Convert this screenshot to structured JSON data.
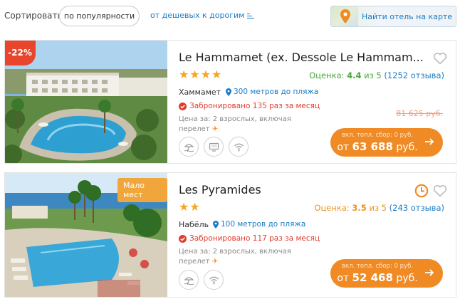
{
  "sort": {
    "label": "Сортировать:",
    "popularity": "по популярности",
    "price": "от дешевых к дорогим",
    "price_icon": "sort-ascending-icon"
  },
  "map": {
    "label": "Найти отель на карте",
    "icon": "map-pin-icon"
  },
  "colors": {
    "accent": "#f08a24",
    "link": "#1a7bc4",
    "discount": "#e8452c",
    "rating_good": "#4aa63f",
    "rating_mid": "#e8961a",
    "booked": "#e23b2e",
    "badge": "#f0a63a"
  },
  "hotels": [
    {
      "discount": "-22%",
      "name": "Le Hammamet (ex. Dessole Le Hammam...",
      "stars": "★★★★",
      "star_count": 4,
      "rating": {
        "label": "Оценка:",
        "value": "4.4",
        "of": "из 5",
        "reviews": "(1252 отзыва)"
      },
      "city": "Хаммамет",
      "beach": "300 метров до пляжа",
      "booked": "Забронировано 135 раз за месяц",
      "old_price": "81 625 руб.",
      "price_note_line1": "Цена за: 2 взрослых, включая",
      "price_note_line2": "перелет",
      "fee": "вкл. топл. сбор: 0 руб.",
      "price_prefix": "от",
      "price": "63 688",
      "currency": "руб.",
      "amenities": [
        "beach-umbrella-icon",
        "tv-icon",
        "wifi-icon"
      ]
    },
    {
      "badge": "Мало мест",
      "name": "Les Pyramides",
      "stars": "★★",
      "star_count": 2,
      "rating": {
        "label": "Оценка:",
        "value": "3.5",
        "of": "из 5",
        "reviews": "(243 отзыва)"
      },
      "city": "Набёль",
      "beach": "100 метров до пляжа",
      "booked": "Забронировано 117 раз за месяц",
      "price_note_line1": "Цена за: 2 взрослых, включая",
      "price_note_line2": "перелет",
      "fee": "вкл. топл. сбор: 0 руб.",
      "price_prefix": "от",
      "price": "52 468",
      "currency": "руб.",
      "amenities": [
        "beach-umbrella-icon",
        "wifi-icon"
      ]
    }
  ]
}
